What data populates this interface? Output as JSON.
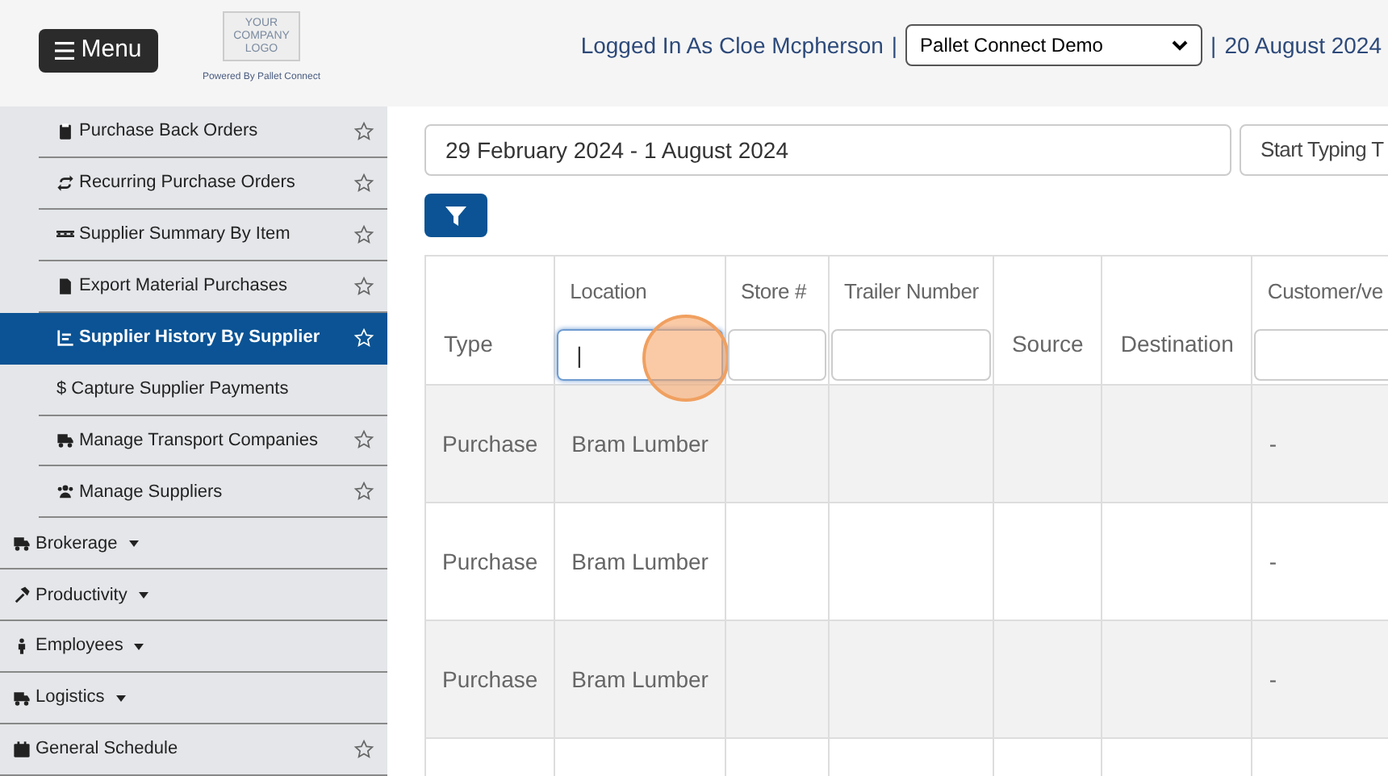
{
  "header": {
    "menu_button": "Menu",
    "logo_text": [
      "YOUR",
      "COMPANY",
      "LOGO"
    ],
    "powered_by": "Powered By Pallet Connect",
    "logged_in": "Logged In As Cloe Mcpherson",
    "separator_1": "|",
    "company_select": "Pallet Connect Demo",
    "separator_2": "|",
    "date": "20 August 2024"
  },
  "sidebar": {
    "items": [
      {
        "kind": "sub",
        "label": "Purchase Back Orders",
        "starred": true,
        "selected": false
      },
      {
        "kind": "sub",
        "label": "Recurring Purchase Orders",
        "starred": true,
        "selected": false
      },
      {
        "kind": "sub",
        "label": "Supplier Summary By Item",
        "starred": true,
        "selected": false
      },
      {
        "kind": "sub",
        "label": "Export Material Purchases",
        "starred": true,
        "selected": false
      },
      {
        "kind": "sub",
        "label": "Supplier History By Supplier",
        "starred": true,
        "selected": true
      },
      {
        "kind": "sub",
        "label": "$ Capture Supplier Payments",
        "starred": false,
        "selected": false
      },
      {
        "kind": "sub",
        "label": "Manage Transport Companies",
        "starred": true,
        "selected": false
      },
      {
        "kind": "sub",
        "label": "Manage Suppliers",
        "starred": true,
        "selected": false
      },
      {
        "kind": "group",
        "label": "Brokerage",
        "starred": false,
        "selected": false
      },
      {
        "kind": "group",
        "label": "Productivity",
        "starred": false,
        "selected": false
      },
      {
        "kind": "group",
        "label": "Employees",
        "starred": false,
        "selected": false
      },
      {
        "kind": "group",
        "label": "Logistics",
        "starred": false,
        "selected": false
      },
      {
        "kind": "link",
        "label": "General Schedule",
        "starred": true,
        "selected": false
      }
    ]
  },
  "filters": {
    "date_range": "29 February 2024 - 1 August 2024",
    "search_placeholder": "Start Typing T"
  },
  "table": {
    "columns": [
      {
        "label": "Type",
        "filter": false
      },
      {
        "label": "Location",
        "filter": true,
        "value": "|",
        "focused": true,
        "clicked": true
      },
      {
        "label": "Store #",
        "filter": true,
        "focused": false,
        "clicked": false
      },
      {
        "label": "Trailer Number",
        "filter": true,
        "focused": false,
        "clicked": false
      },
      {
        "label": "Source",
        "filter": false
      },
      {
        "label": "Destination",
        "filter": false
      },
      {
        "label": "Customer/ve",
        "filter": true,
        "focused": false,
        "clicked": false
      }
    ],
    "rows": [
      {
        "cells": [
          "Purchase",
          "Bram Lumber",
          "",
          "",
          "",
          "",
          "-"
        ]
      },
      {
        "cells": [
          "Purchase",
          "Bram Lumber",
          "",
          "",
          "",
          "",
          "-"
        ]
      },
      {
        "cells": [
          "Purchase",
          "Bram Lumber",
          "",
          "",
          "",
          "",
          "-"
        ]
      }
    ]
  }
}
